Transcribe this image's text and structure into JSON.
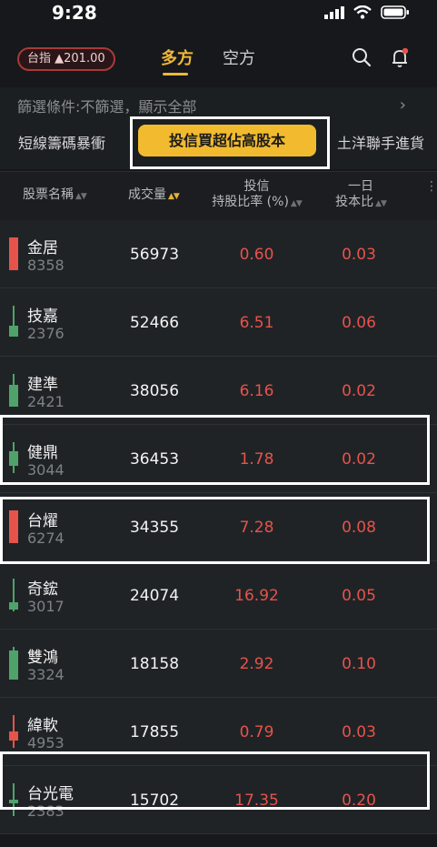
{
  "status": {
    "time": "9:28"
  },
  "top": {
    "index_pill": "台指 ▲201.00",
    "tabs": [
      "多方",
      "空方"
    ],
    "search_icon": "search-icon",
    "bell_icon": "bell-icon"
  },
  "filter": {
    "text": "篩選條件:不篩選，顯示全部",
    "chevron": "›"
  },
  "strategies": [
    "短線籌碼暴衝",
    "投信買超佔高股本",
    "土洋聯手進貨"
  ],
  "columns": {
    "name": "股票名稱",
    "volume": "成交量",
    "ratio_l1": "投信",
    "ratio_l2": "持股比率 (%)",
    "day_l1": "一日",
    "day_l2": "投本比"
  },
  "rows": [
    {
      "name": "金居",
      "code": "8358",
      "volume": "56973",
      "ratio": "0.60",
      "day": "0.03",
      "candle": "red"
    },
    {
      "name": "技嘉",
      "code": "2376",
      "volume": "52466",
      "ratio": "6.51",
      "day": "0.06",
      "candle": "green"
    },
    {
      "name": "建準",
      "code": "2421",
      "volume": "38056",
      "ratio": "6.16",
      "day": "0.02",
      "candle": "green"
    },
    {
      "name": "健鼎",
      "code": "3044",
      "volume": "36453",
      "ratio": "1.78",
      "day": "0.02",
      "candle": "green"
    },
    {
      "name": "台燿",
      "code": "6274",
      "volume": "34355",
      "ratio": "7.28",
      "day": "0.08",
      "candle": "red"
    },
    {
      "name": "奇鋐",
      "code": "3017",
      "volume": "24074",
      "ratio": "16.92",
      "day": "0.05",
      "candle": "green"
    },
    {
      "name": "雙鴻",
      "code": "3324",
      "volume": "18158",
      "ratio": "2.92",
      "day": "0.10",
      "candle": "green"
    },
    {
      "name": "緯軟",
      "code": "4953",
      "volume": "17855",
      "ratio": "0.79",
      "day": "0.03",
      "candle": "red"
    },
    {
      "name": "台光電",
      "code": "2383",
      "volume": "15702",
      "ratio": "17.35",
      "day": "0.20",
      "candle": "green"
    }
  ],
  "colors": {
    "up": "#e5534b",
    "down": "#4fa36a",
    "accent": "#f2bb2f"
  }
}
